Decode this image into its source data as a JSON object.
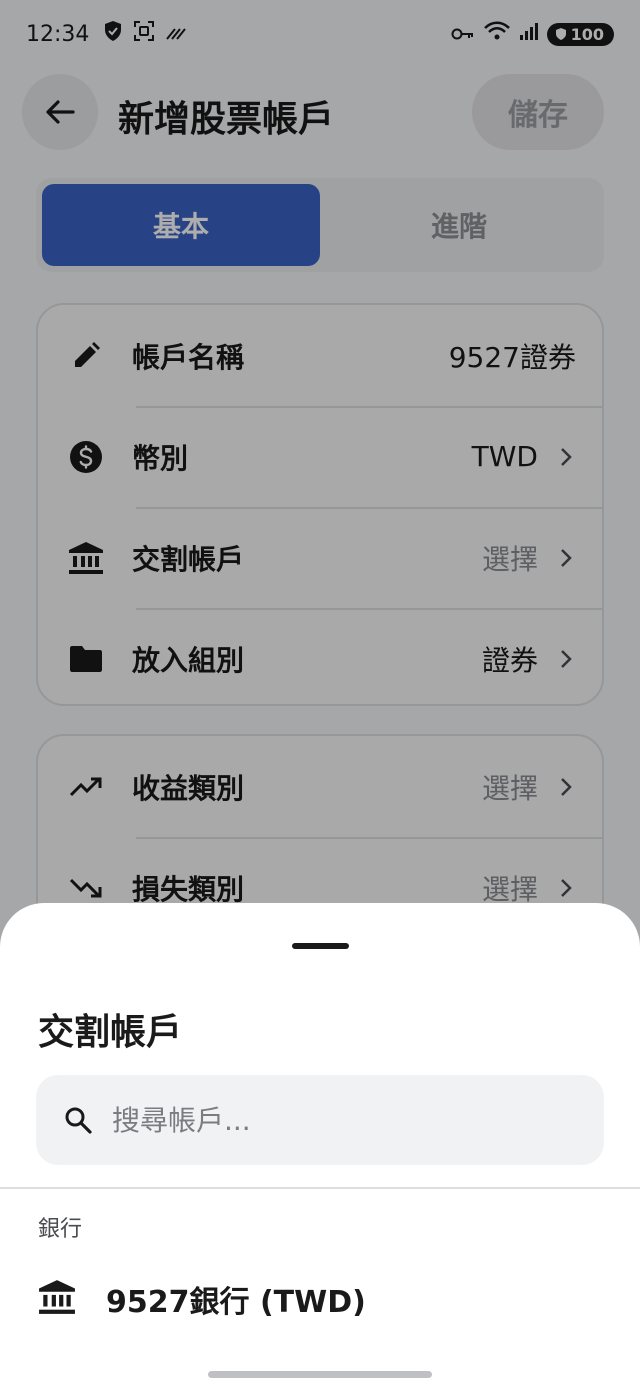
{
  "status_bar": {
    "time": "12:34",
    "battery": "100"
  },
  "header": {
    "title": "新增股票帳戶",
    "save_label": "儲存"
  },
  "tabs": [
    {
      "label": "基本",
      "active": true
    },
    {
      "label": "進階",
      "active": false
    }
  ],
  "basic_card": {
    "rows": [
      {
        "label": "帳戶名稱",
        "value": "9527證券",
        "icon": "pencil-icon"
      },
      {
        "label": "幣別",
        "value": "TWD",
        "icon": "dollar-icon"
      },
      {
        "label": "交割帳戶",
        "value": "選擇",
        "icon": "bank-icon"
      },
      {
        "label": "放入組別",
        "value": "證券",
        "icon": "folder-icon"
      }
    ]
  },
  "category_card": {
    "rows": [
      {
        "label": "收益類別",
        "value": "選擇",
        "icon": "trending-up-icon"
      },
      {
        "label": "損失類別",
        "value": "選擇",
        "icon": "trending-down-icon"
      }
    ]
  },
  "sheet": {
    "title": "交割帳戶",
    "search_placeholder": "搜尋帳戶...",
    "section_label": "銀行",
    "accounts": [
      {
        "name": "9527銀行 (TWD)",
        "icon": "bank-icon"
      }
    ]
  },
  "colors": {
    "accent": "#3a64c4",
    "background": "#f5f6f8",
    "scrim": "rgba(0,0,0,0.32)"
  }
}
